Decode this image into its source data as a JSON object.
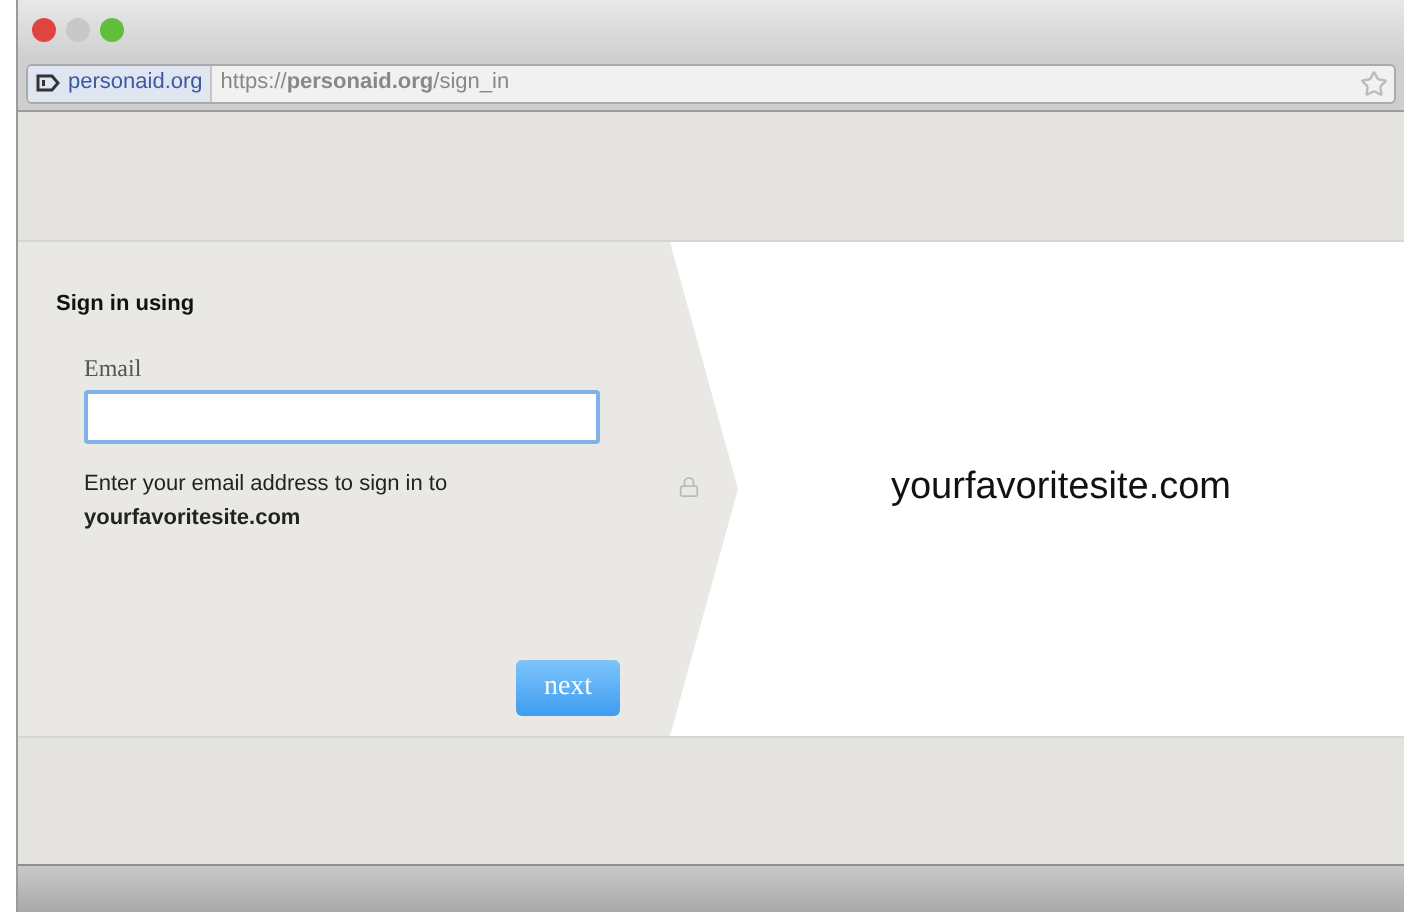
{
  "window_controls": [
    {
      "color": "#e0443e"
    },
    {
      "color": "#c8c8c8"
    },
    {
      "color": "#5fbf3a"
    }
  ],
  "address_bar": {
    "site_badge": "personaid.org",
    "url": "https://**personaid.org**/sign_in"
  },
  "sign_in": {
    "heading": "Sign in using",
    "email_label": "Email",
    "hint": "Enter your email address to sign in to",
    "site": "yourfavoritesite.com",
    "button": "next"
  },
  "destination": {
    "site": "yourfavoritesite.com"
  }
}
